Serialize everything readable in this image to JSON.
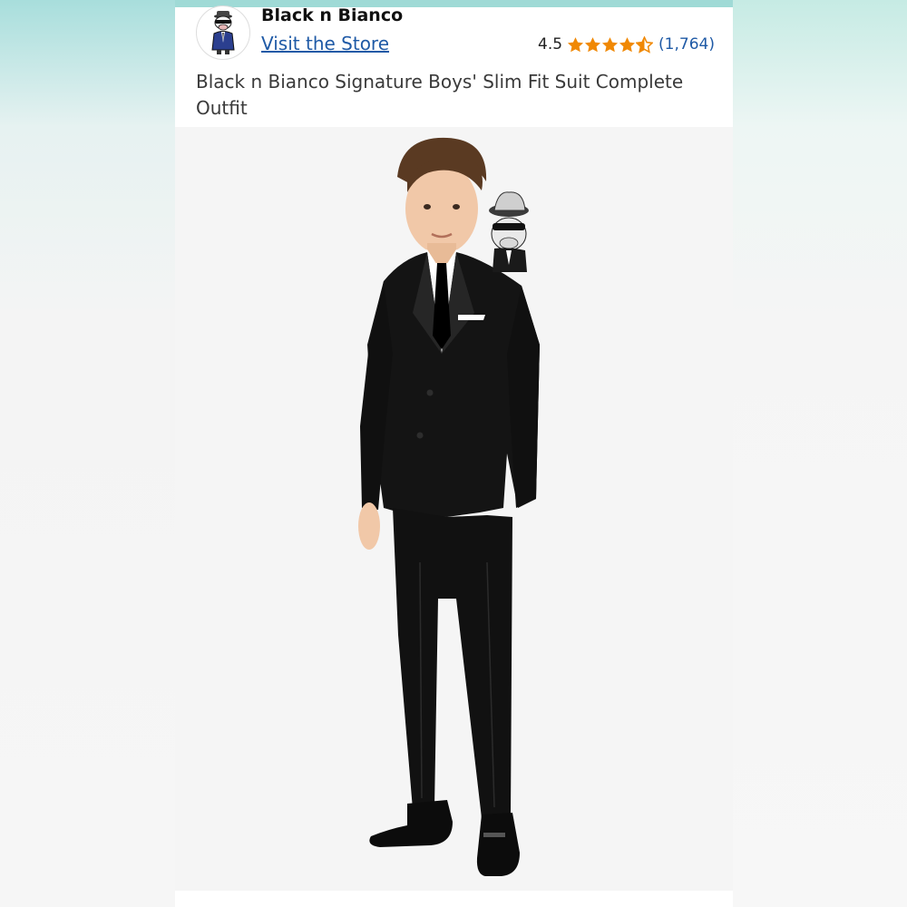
{
  "store": {
    "brand_name": "Black n Bianco",
    "visit_link": "Visit the Store",
    "logo_icon": "cow-mascot-logo"
  },
  "rating": {
    "value": "4.5",
    "stars": 4.5,
    "count": "(1,764)",
    "star_color": "#f08804"
  },
  "product": {
    "title": "Black n Bianco Signature Boys' Slim Fit Suit Complete Outfit",
    "image": "boy-in-black-slim-fit-suit-photo"
  },
  "colors": {
    "link": "#1f5aa6",
    "accent_strip": "#9fdad6"
  }
}
